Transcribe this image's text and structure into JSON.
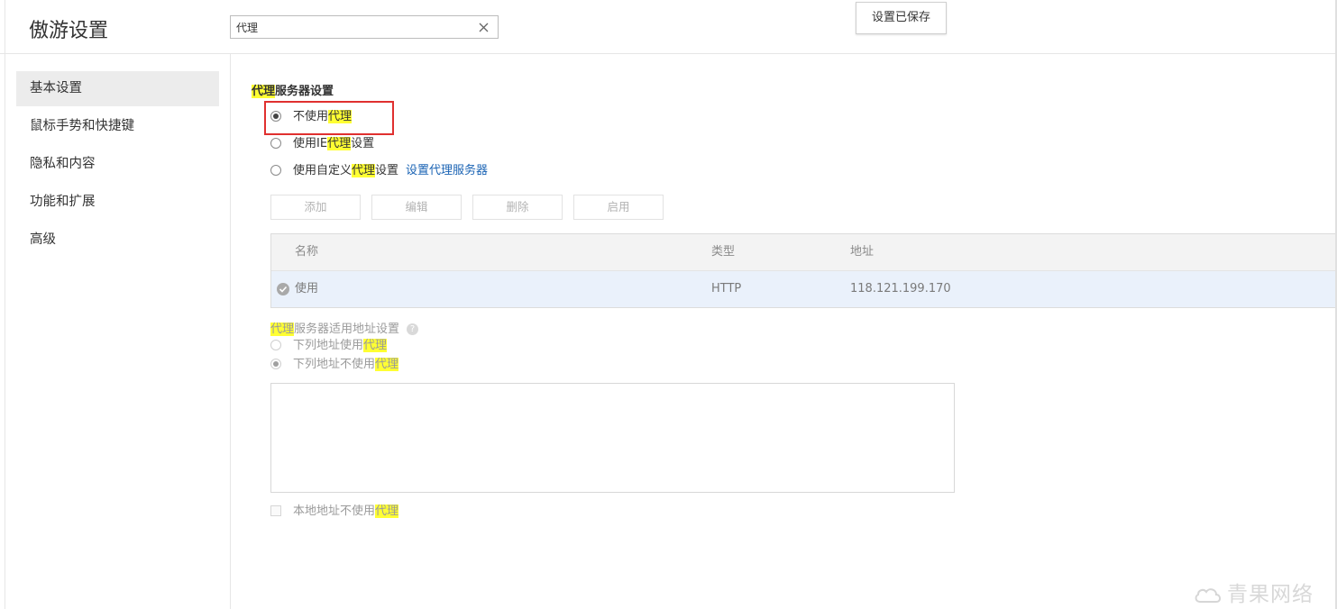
{
  "app": {
    "title": "傲游设置"
  },
  "search": {
    "value": "代理"
  },
  "saved_button": {
    "label": "设置已保存"
  },
  "sidebar": {
    "items": [
      {
        "label": "基本设置",
        "active": true
      },
      {
        "label": "鼠标手势和快捷键"
      },
      {
        "label": "隐私和内容"
      },
      {
        "label": "功能和扩展"
      },
      {
        "label": "高级"
      }
    ]
  },
  "proxy": {
    "section_title_highlight": "代理",
    "section_title_rest": "服务器设置",
    "options": {
      "none": {
        "prefix": "不使用",
        "highlight": "代理",
        "suffix": "",
        "checked": true
      },
      "ie": {
        "prefix": "使用IE",
        "highlight": "代理",
        "suffix": "设置",
        "checked": false
      },
      "custom": {
        "prefix": "使用自定义",
        "highlight": "代理",
        "suffix": "设置",
        "checked": false,
        "link": "设置代理服务器"
      }
    },
    "buttons": {
      "add": "添加",
      "edit": "编辑",
      "delete": "删除",
      "enable": "启用"
    },
    "table": {
      "columns": {
        "name": "名称",
        "type": "类型",
        "address": "地址"
      },
      "rows": [
        {
          "name": "使用",
          "type": "HTTP",
          "address": "118.121.199.170"
        }
      ]
    },
    "address_section": {
      "title_highlight": "代理",
      "title_rest": "服务器适用地址设置",
      "use_list": {
        "prefix": "下列地址使用",
        "highlight": "代理",
        "checked": false
      },
      "bypass_list": {
        "prefix": "下列地址不使用",
        "highlight": "代理",
        "checked": true
      },
      "textarea_value": "",
      "local_bypass": {
        "prefix": "本地地址不使用",
        "highlight": "代理",
        "checked": false
      }
    }
  },
  "watermark": {
    "text": "青果网络"
  },
  "colors": {
    "highlight": "#ffff33",
    "link": "#1a63b4",
    "annotation_border": "#e0302f",
    "selected_row": "#eaf1fb"
  }
}
